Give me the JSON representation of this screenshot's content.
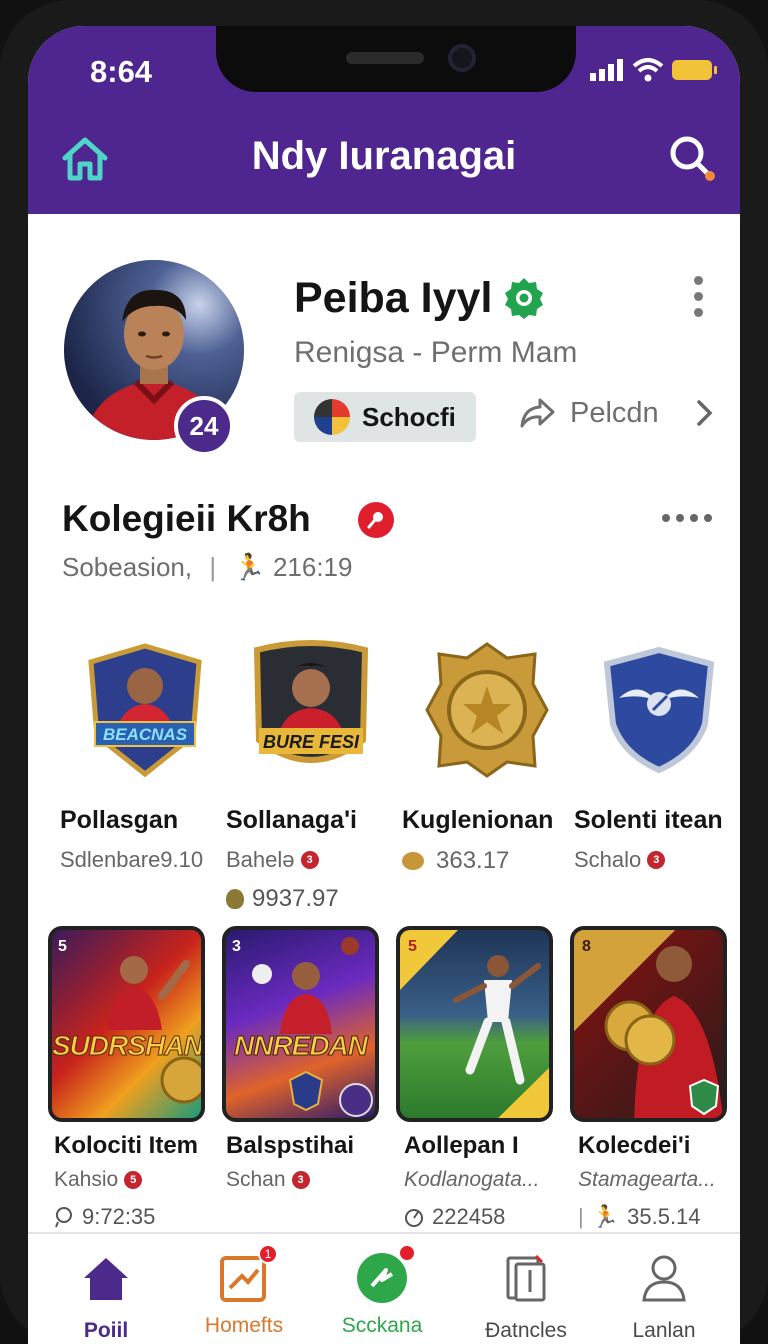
{
  "status_bar": {
    "time": "8:64"
  },
  "header": {
    "title": "Ndy Iuranagai"
  },
  "profile": {
    "name": "Peiba Iyyl",
    "subtitle": "Renigsa - Perm Mam",
    "avatar_badge": "24",
    "club_chip": "Schocfi",
    "share_label": "Pelcdn"
  },
  "section": {
    "title": "Kolegieii Kr8h",
    "meta_left": "Sobeasion,",
    "meta_right": "216:19"
  },
  "badges": [
    {
      "title": "Pollasgan",
      "sub": "Sdlenbare9.10",
      "art_text": "BEACNAS"
    },
    {
      "title": "Sollanaga'i",
      "sub": "Bahelə",
      "extra": "9937.97",
      "art_text": "BURE FESI"
    },
    {
      "title": "Kuglenionan",
      "sub": "363.17"
    },
    {
      "title": "Solenti itean",
      "sub": "Schalo"
    }
  ],
  "cards": [
    {
      "title": "Kolociti Item",
      "sub": "Kahsio",
      "extra": "9:72:35",
      "art_text": "SUDRSHAN",
      "corner": "5"
    },
    {
      "title": "Balspstihai",
      "sub": "Schan",
      "art_text": "NNREDAN",
      "corner": "3"
    },
    {
      "title": "Aollepan I",
      "sub": "Kodlanogata...",
      "extra": "222458",
      "corner": "5"
    },
    {
      "title": "Kolecdei'i",
      "sub": "Stamagearta...",
      "extra": "35.5.14",
      "corner": "8"
    }
  ],
  "bottom_nav": [
    {
      "label": "Poiil",
      "active": true
    },
    {
      "label": "Homefts",
      "badge": "1"
    },
    {
      "label": "Scckana"
    },
    {
      "label": "Ɖatncles"
    },
    {
      "label": "Lanlan"
    }
  ],
  "colors": {
    "header": "#4f2590",
    "accent_red": "#df1f2e",
    "nav_active": "#4b2a8b",
    "nav_orange": "#d9782b",
    "nav_green": "#2ea64a"
  }
}
